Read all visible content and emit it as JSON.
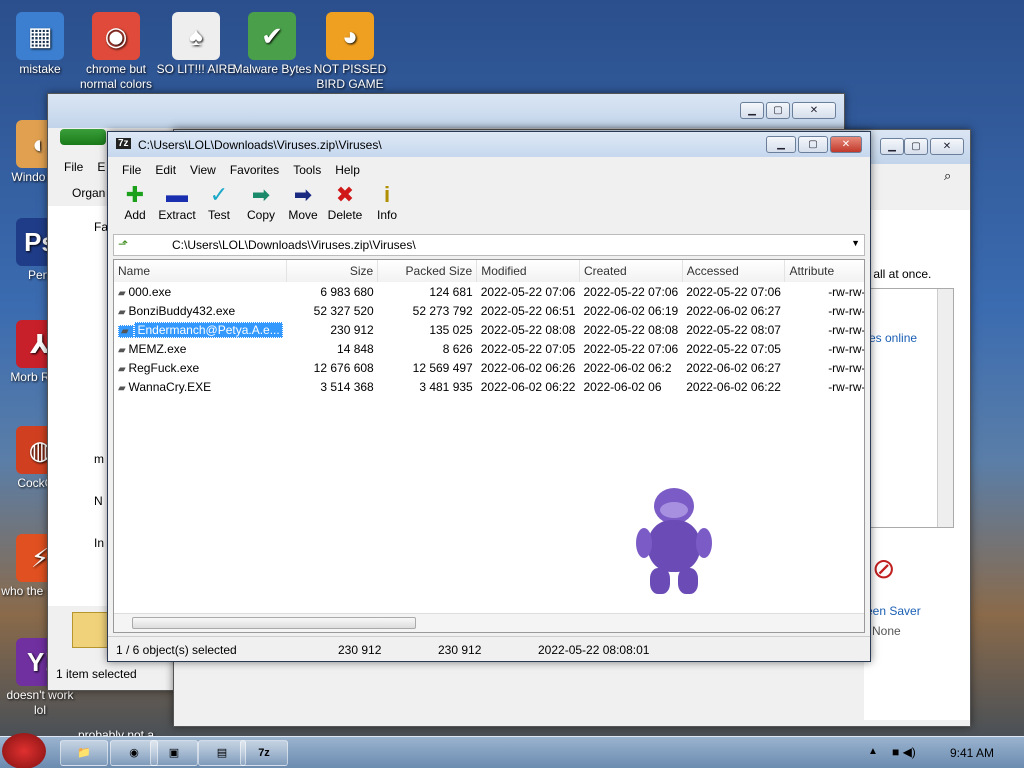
{
  "desktop_icons": [
    {
      "label": "mistake",
      "glyph": "▦",
      "color": "#3c7fd0"
    },
    {
      "label": "chrome but normal colors",
      "glyph": "◉",
      "color": "#e04a3a"
    },
    {
      "label": "SO LIT!!! AIRE",
      "glyph": "♠",
      "color": "#eeeeee"
    },
    {
      "label": "Malware Bytes",
      "glyph": "✔",
      "color": "#4aa04a"
    },
    {
      "label": "NOT PISSED BIRD GAME",
      "glyph": "◕",
      "color": "#f0a020"
    },
    {
      "label": "Windo Vist",
      "glyph": "◐",
      "color": "#e0a050"
    },
    {
      "label": "Peni",
      "glyph": "Ps",
      "color": "#1f3c88"
    },
    {
      "label": "Morb Read",
      "glyph": "⅄",
      "color": "#c8202a"
    },
    {
      "label": "CockCle",
      "glyph": "◍",
      "color": "#d04020"
    },
    {
      "label": "who the uses t",
      "glyph": "⚡",
      "color": "#e05020"
    },
    {
      "label": "doesn't work lol",
      "glyph": "Y!",
      "color": "#7030a0"
    },
    {
      "label": "probably not a rogue",
      "glyph": "",
      "color": "transparent"
    }
  ],
  "explorer": {
    "menu": [
      "File",
      "E"
    ],
    "organize": "Organ",
    "status": "1 item selected",
    "tree": [
      "Fa",
      "m",
      "N",
      "In"
    ]
  },
  "control_panel": {
    "text1": "r all at once.",
    "link": "es online",
    "screensaver_label": "een Saver",
    "screensaver_value": "None"
  },
  "sevenzip": {
    "title": "C:\\Users\\LOL\\Downloads\\Viruses.zip\\Viruses\\",
    "menu": [
      "File",
      "Edit",
      "View",
      "Favorites",
      "Tools",
      "Help"
    ],
    "toolbar": [
      {
        "label": "Add",
        "glyph": "✚",
        "color": "#1aa01a"
      },
      {
        "label": "Extract",
        "glyph": "▬",
        "color": "#1a2fb0"
      },
      {
        "label": "Test",
        "glyph": "✓",
        "color": "#18a8c8"
      },
      {
        "label": "Copy",
        "glyph": "➡",
        "color": "#1a8a6a"
      },
      {
        "label": "Move",
        "glyph": "➡",
        "color": "#1a2a80"
      },
      {
        "label": "Delete",
        "glyph": "✖",
        "color": "#d01818"
      },
      {
        "label": "Info",
        "glyph": "i",
        "color": "#b09000"
      }
    ],
    "address": "C:\\Users\\LOL\\Downloads\\Viruses.zip\\Viruses\\",
    "columns": [
      "Name",
      "Size",
      "Packed Size",
      "Modified",
      "Created",
      "Accessed",
      "Attribute"
    ],
    "files": [
      {
        "name": "000.exe",
        "size": "6 983 680",
        "packed": "124 681",
        "modified": "2022-05-22 07:06",
        "created": "2022-05-22 07:06",
        "accessed": "2022-05-22 07:06",
        "attr": "-rw-rw--"
      },
      {
        "name": "BonziBuddy432.exe",
        "size": "52 327 520",
        "packed": "52 273 792",
        "modified": "2022-05-22 06:51",
        "created": "2022-06-02 06:19",
        "accessed": "2022-06-02 06:27",
        "attr": "-rw-rw--"
      },
      {
        "name": "Endermanch@Petya.A.e...",
        "size": "230 912",
        "packed": "135 025",
        "modified": "2022-05-22 08:08",
        "created": "2022-05-22 08:08",
        "accessed": "2022-05-22 08:07",
        "attr": "-rw-rw--"
      },
      {
        "name": "MEMZ.exe",
        "size": "14 848",
        "packed": "8 626",
        "modified": "2022-05-22 07:05",
        "created": "2022-05-22 07:06",
        "accessed": "2022-05-22 07:05",
        "attr": "-rw-rw--"
      },
      {
        "name": "RegFuck.exe",
        "size": "12 676 608",
        "packed": "12 569 497",
        "modified": "2022-06-02 06:26",
        "created": "2022-06-02 06:2",
        "accessed": "2022-06-02 06:27",
        "attr": "-rw-rw--"
      },
      {
        "name": "WannaCry.EXE",
        "size": "3 514 368",
        "packed": "3 481 935",
        "modified": "2022-06-02 06:22",
        "created": "2022-06-02 06",
        "accessed": "2022-06-02 06:22",
        "attr": "-rw-rw--"
      }
    ],
    "selected_index": 2,
    "status": {
      "selection": "1 / 6 object(s) selected",
      "size": "230 912",
      "packed": "230 912",
      "modified": "2022-05-22 08:08:01"
    }
  },
  "taskbar": {
    "time": "9:41 AM"
  },
  "colors": {
    "selection": "#3399ff",
    "bonzi": "#7b5cc6"
  }
}
